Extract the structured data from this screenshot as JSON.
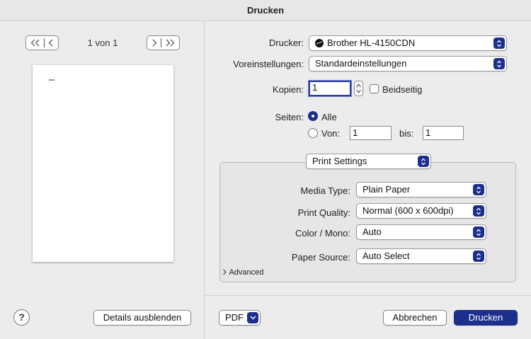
{
  "window": {
    "title": "Drucken"
  },
  "preview": {
    "first_icon": "first-page-icon",
    "prev_icon": "previous-page-icon",
    "next_icon": "next-page-icon",
    "last_icon": "last-page-icon",
    "page_indicator": "1 von 1"
  },
  "left_footer": {
    "help_label": "?",
    "details_label": "Details ausblenden"
  },
  "form": {
    "printer_label": "Drucker:",
    "printer_value": "Brother HL-4150CDN",
    "presets_label": "Voreinstellungen:",
    "presets_value": "Standardeinstellungen",
    "copies_label": "Kopien:",
    "copies_value": "1",
    "duplex_label": "Beidseitig",
    "duplex_checked": false,
    "pages_label": "Seiten:",
    "pages_all_label": "Alle",
    "pages_all_selected": true,
    "pages_from_label": "Von:",
    "pages_from_value": "1",
    "pages_to_label": "bis:",
    "pages_to_value": "1"
  },
  "section": {
    "selected": "Print Settings",
    "media_type_label": "Media Type:",
    "media_type_value": "Plain Paper",
    "quality_label": "Print Quality:",
    "quality_value": "Normal (600 x 600dpi)",
    "color_label": "Color / Mono:",
    "color_value": "Auto",
    "source_label": "Paper Source:",
    "source_value": "Auto Select",
    "advanced_label": "Advanced"
  },
  "footer": {
    "pdf_label": "PDF",
    "cancel_label": "Abbrechen",
    "print_label": "Drucken"
  },
  "colors": {
    "accent": "#1d2f8c",
    "background": "#ececec"
  }
}
